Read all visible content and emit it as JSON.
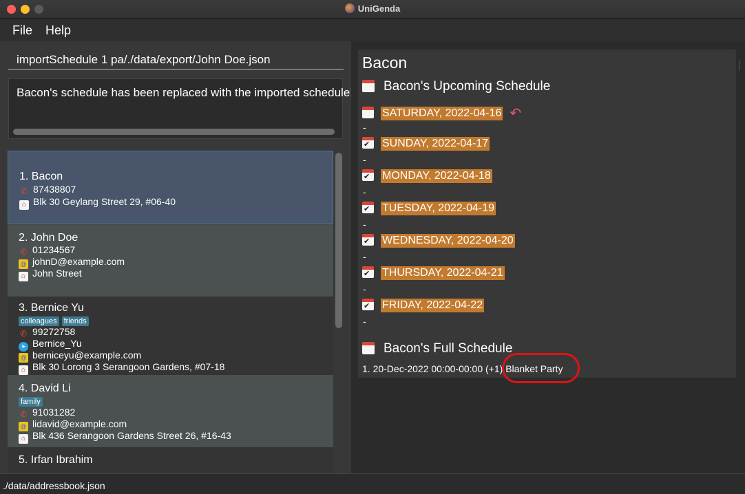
{
  "window": {
    "title": "UniGenda"
  },
  "menu": {
    "file": "File",
    "help": "Help"
  },
  "command": {
    "value": "importSchedule 1 pa/./data/export/John Doe.json"
  },
  "result": {
    "text": "Bacon's schedule has been replaced with the imported schedule!"
  },
  "persons": [
    {
      "index_name": "1.  Bacon",
      "phone": "87438807",
      "address": "Blk 30 Geylang Street 29, #06-40"
    },
    {
      "index_name": "2.  John Doe",
      "phone": "01234567",
      "email": "johnD@example.com",
      "address": "John Street"
    },
    {
      "index_name": "3.  Bernice Yu",
      "tags": [
        "colleagues",
        "friends"
      ],
      "phone": "99272758",
      "telegram": "Bernice_Yu",
      "email": "berniceyu@example.com",
      "address": "Blk 30 Lorong 3 Serangoon Gardens, #07-18"
    },
    {
      "index_name": "4.  David Li",
      "tags": [
        "family"
      ],
      "phone": "91031282",
      "email": "lidavid@example.com",
      "address": "Blk 436 Serangoon Gardens Street 26, #16-43"
    },
    {
      "index_name": "5.  Irfan Ibrahim"
    }
  ],
  "schedule": {
    "name": "Bacon",
    "upcoming_title": "Bacon's Upcoming Schedule",
    "days": [
      "SATURDAY, 2022-04-16",
      "SUNDAY, 2022-04-17",
      "MONDAY, 2022-04-18",
      "TUESDAY, 2022-04-19",
      "WEDNESDAY, 2022-04-20",
      "THURSDAY, 2022-04-21",
      "FRIDAY, 2022-04-22"
    ],
    "empty_marker": "-",
    "full_title": "Bacon's Full Schedule",
    "full_items": [
      "1. 20-Dec-2022 00:00-00:00 (+1) Blanket Party"
    ]
  },
  "status": {
    "path": "./data/addressbook.json"
  },
  "colors": {
    "accent_day": "#c27a2e",
    "selected_card": "#48556a",
    "tag": "#3e7b91",
    "highlight": "#e01414"
  }
}
